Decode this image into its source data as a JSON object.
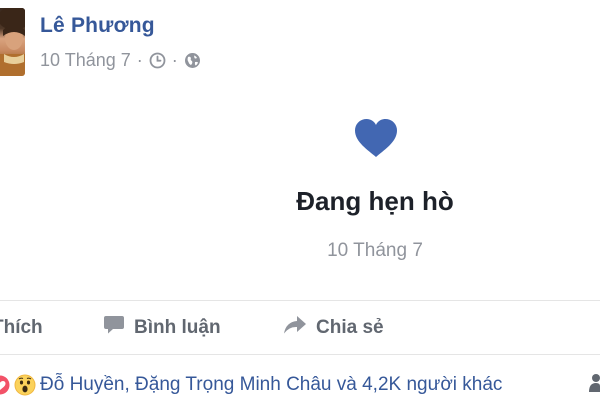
{
  "post": {
    "author": "Lê Phương",
    "date": "10 Tháng 7",
    "separator": "·",
    "clock_icon": "clock-icon",
    "privacy_icon": "globe-icon"
  },
  "life_event": {
    "icon": "heart-icon",
    "icon_color": "#4267b2",
    "title": "Đang hẹn hò",
    "date": "10 Tháng 7"
  },
  "actions": {
    "like_label": "Thích",
    "comment_label": "Bình luận",
    "share_label": "Chia sẻ",
    "comment_icon": "comment-icon",
    "share_icon": "share-icon"
  },
  "reactions": {
    "icons": [
      "love-reaction-icon",
      "wow-reaction-icon"
    ],
    "summary": "Đỗ Huyền, Đặng Trọng Minh Châu và 4,2K người khác"
  },
  "colors": {
    "link": "#365899",
    "muted": "#90949c",
    "action": "#616770",
    "text": "#1d2129"
  }
}
